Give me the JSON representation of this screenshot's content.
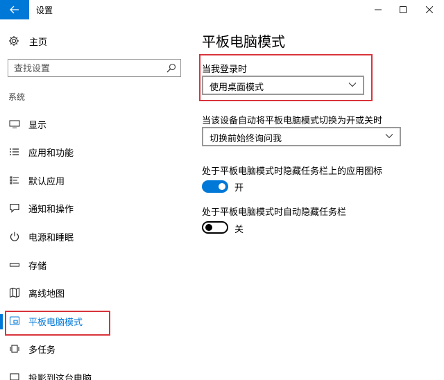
{
  "window": {
    "title": "设置",
    "back_icon": "arrow-left-icon",
    "accent": "#0078d7"
  },
  "sidebar": {
    "home_label": "主页",
    "search": {
      "placeholder": "查找设置",
      "value": ""
    },
    "section_label": "系统",
    "items": [
      {
        "label": "显示",
        "icon": "monitor-icon",
        "active": false
      },
      {
        "label": "应用和功能",
        "icon": "list-icon",
        "active": false
      },
      {
        "label": "默认应用",
        "icon": "default-apps-icon",
        "active": false
      },
      {
        "label": "通知和操作",
        "icon": "message-icon",
        "active": false
      },
      {
        "label": "电源和睡眠",
        "icon": "power-icon",
        "active": false
      },
      {
        "label": "存储",
        "icon": "storage-icon",
        "active": false
      },
      {
        "label": "离线地图",
        "icon": "map-icon",
        "active": false
      },
      {
        "label": "平板电脑模式",
        "icon": "tablet-mode-icon",
        "active": true
      },
      {
        "label": "多任务",
        "icon": "multitask-icon",
        "active": false
      },
      {
        "label": "投影到这台电脑",
        "icon": "project-icon",
        "active": false
      }
    ]
  },
  "main": {
    "title": "平板电脑模式",
    "signin_label": "当我登录时",
    "signin_value": "使用桌面模式",
    "autoswitch_label": "当该设备自动将平板电脑模式切换为开或关时",
    "autoswitch_value": "切换前始终询问我",
    "hide_icons_label": "处于平板电脑模式时隐藏任务栏上的应用图标",
    "hide_icons_state": "开",
    "hide_taskbar_label": "处于平板电脑模式时自动隐藏任务栏",
    "hide_taskbar_state": "关"
  },
  "highlight_color": "#d9343c"
}
